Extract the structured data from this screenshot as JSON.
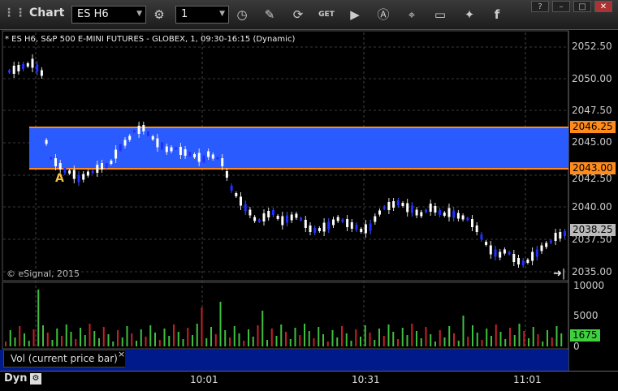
{
  "titlebar": {
    "title": "Chart",
    "symbol": "ES H6",
    "interval": "1",
    "toolbar_icons": [
      "settings-gear-icon",
      "clock-icon",
      "pencil-icon",
      "refresh-icon",
      "get-icon",
      "play-icon",
      "a-icon",
      "tag-icon",
      "comment-icon",
      "twitter-icon",
      "facebook-icon"
    ],
    "window_buttons": [
      "help-icon",
      "minimize-icon",
      "maximize-icon",
      "close-icon"
    ]
  },
  "chart": {
    "header": "* ES H6, S&P 500 E-MINI FUTURES - GLOBEX, 1, 09:30-16:15 (Dynamic)",
    "copyright": "© eSignal, 2015",
    "price_ticks": [
      "2052.50",
      "2050.00",
      "2047.50",
      "2045.00",
      "2042.50",
      "2040.00",
      "2037.50",
      "2035.00"
    ],
    "upper_level": "2046.25",
    "lower_level": "2043.00",
    "last_price": "2038.25",
    "marker_label": "A",
    "band_color": "#2a5bff",
    "level_color": "#ff8c1a"
  },
  "volume": {
    "label": "Vol (current price bar)",
    "close_glyph": "×",
    "ticks": [
      "10000",
      "5000",
      "0"
    ],
    "last_volume": "1675"
  },
  "bottom": {
    "dyn": "Dyn",
    "times": [
      "10:01",
      "10:31",
      "11:01"
    ]
  }
}
